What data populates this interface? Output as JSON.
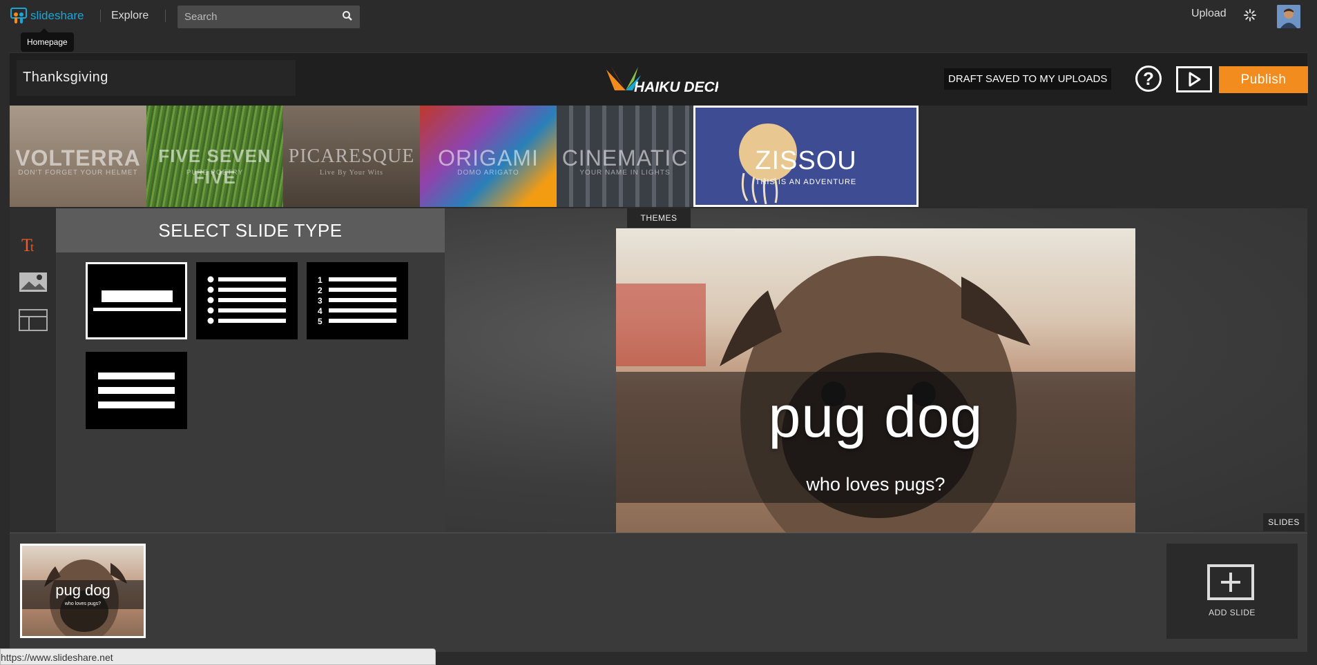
{
  "topbar": {
    "logo_text": "slideshare",
    "explore_label": "Explore",
    "search_placeholder": "Search",
    "upload_label": "Upload",
    "tooltip": "Homepage"
  },
  "deck": {
    "title": "Thanksgiving",
    "brand": "HAIKU DECK",
    "draft_status": "DRAFT SAVED TO MY UPLOADS",
    "help_label": "?",
    "publish_label": "Publish"
  },
  "themes": {
    "tab_label": "THEMES",
    "items": [
      {
        "name": "VOLTERRA",
        "sub": "DON'T FORGET YOUR HELMET",
        "color": "#8a7a6c"
      },
      {
        "name": "FIVE SEVEN FIVE",
        "sub": "PURE POETRY",
        "color": "#4d7a30"
      },
      {
        "name": "PICARESQUE",
        "sub": "Live By Your Wits",
        "color": "#5e5247"
      },
      {
        "name": "ORIGAMI",
        "sub": "DOMO ARIGATO",
        "color": "#6a4a7a"
      },
      {
        "name": "CINEMATIC",
        "sub": "YOUR NAME IN LIGHTS",
        "color": "#4a4e55"
      },
      {
        "name": "ZISSOU",
        "sub": "THIS IS AN ADVENTURE",
        "color": "#3d4c93"
      }
    ]
  },
  "slide_type_panel": {
    "heading": "SELECT SLIDE TYPE",
    "numbers": [
      "1",
      "2",
      "3",
      "4",
      "5"
    ]
  },
  "slide": {
    "title": "pug dog",
    "subtitle": "who loves pugs?"
  },
  "slides_panel": {
    "tab_label": "SLIDES",
    "thumb_title": "pug dog",
    "thumb_subtitle": "who loves pugs?",
    "add_slide_label": "ADD SLIDE"
  },
  "status_url": "https://www.slideshare.net",
  "colors": {
    "accent": "#f28c1e",
    "slideshare_blue": "#19a6d6",
    "tool_active": "#f05a28"
  }
}
